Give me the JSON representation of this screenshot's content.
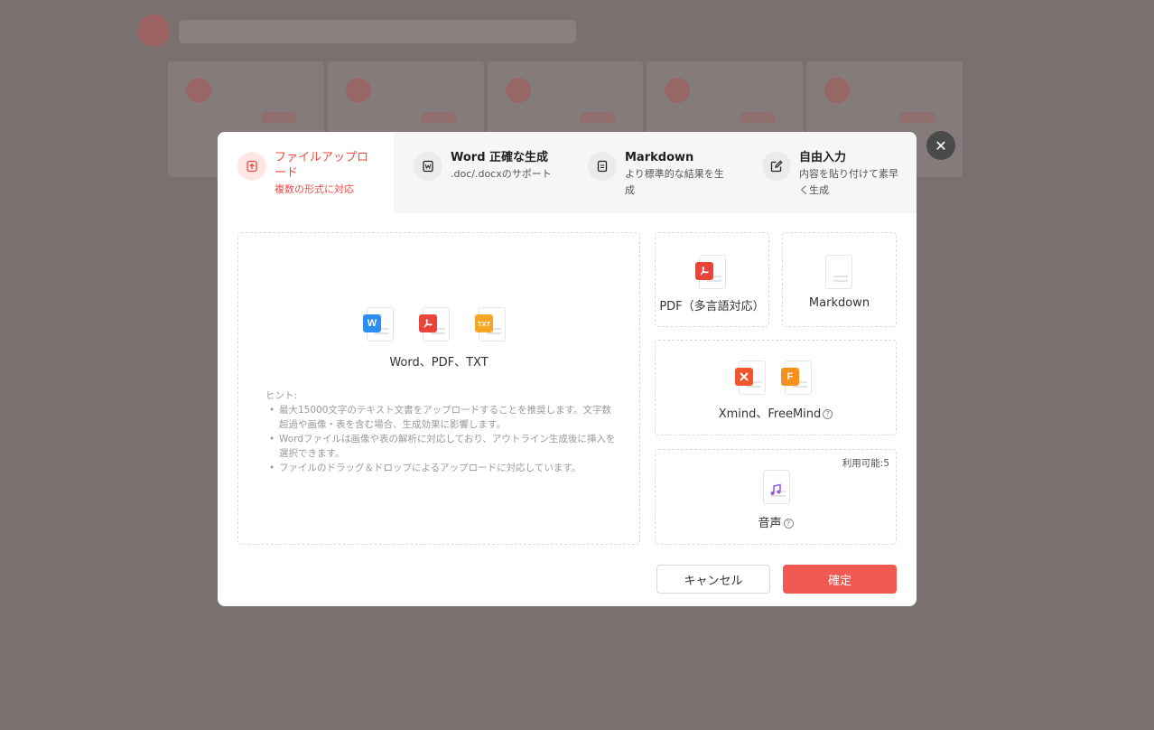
{
  "tabs": [
    {
      "title": "ファイルアップロード",
      "sub": "複数の形式に対応",
      "icon": "upload-icon"
    },
    {
      "title": "Word 正確な生成",
      "sub": ".doc/.docxのサポート",
      "icon": "word-icon"
    },
    {
      "title": "Markdown",
      "sub": "より標準的な結果を生成",
      "icon": "document-icon"
    },
    {
      "title": "自由入力",
      "sub": "内容を貼り付けて素早く生成",
      "icon": "edit-icon"
    }
  ],
  "upload": {
    "label": "Word、PDF、TXT",
    "file_badges": [
      "W",
      "",
      "TXT"
    ],
    "hint_title": "ヒント:",
    "hints": [
      "最大15000文字のテキスト文書をアップロードすることを推奨します。文字数超過や画像・表を含む場合、生成効果に影響します。",
      "Wordファイルは画像や表の解析に対応しており、アウトライン生成後に挿入を選択できます。",
      "ファイルのドラッグ＆ドロップによるアップロードに対応しています。"
    ]
  },
  "cards": {
    "pdf": "PDF（多言語対応）",
    "markdown": "Markdown",
    "xmind": "Xmind、FreeMind",
    "xmind_badges": [
      "",
      "F"
    ],
    "audio": "音声",
    "audio_available": "利用可能:5",
    "help_glyph": "?"
  },
  "footer": {
    "cancel": "キャンセル",
    "ok": "確定"
  },
  "close_glyph": "✕",
  "colors": {
    "accent": "#f05a52",
    "active_text": "#ec4a41",
    "word": "#2b8ff0",
    "pdf": "#e8443a",
    "txt": "#f5a623",
    "xmind": "#f0552e",
    "freemind": "#f7911d",
    "audio": "#9b59e8"
  }
}
